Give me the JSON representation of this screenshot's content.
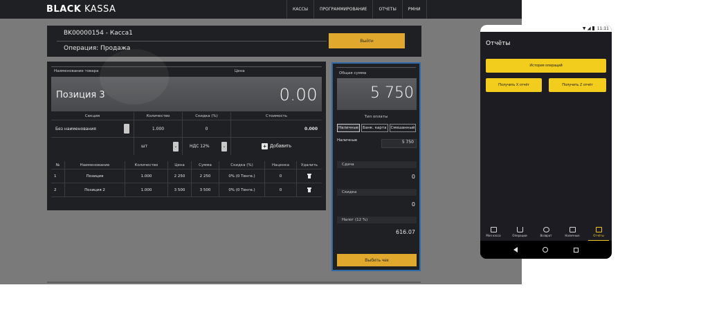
{
  "brand": {
    "bold": "BLACK",
    "light": " KASSA"
  },
  "nav": [
    "КАССЫ",
    "ПРОГРАММИРОВАНИЕ",
    "ОТЧЕТЫ",
    "РМНИ"
  ],
  "header": {
    "kassa_name": "BK00000154 - Касса1",
    "operation": "Операция: Продажа",
    "exit_label": "Выйти"
  },
  "item": {
    "name_label": "Наименование товара",
    "price_label": "Цена",
    "name": "Позиция 3",
    "price": "0.00"
  },
  "entry": {
    "headers": [
      "Секция",
      "Количество",
      "Скидка (%)",
      "Стоимость"
    ],
    "section_value": "Без наименования",
    "quantity": "1.000",
    "discount": "0",
    "cost": "0.000",
    "unit": "шт",
    "tax": "НДС 12%",
    "add_label": "Добавить"
  },
  "table": {
    "headers": [
      "№",
      "Наименование",
      "Количество",
      "Цена",
      "Сумма",
      "Скидка (%)",
      "Наценка",
      "Удалить"
    ],
    "rows": [
      [
        "1",
        "Позиция",
        "1.000",
        "2 250",
        "2 250",
        "0% (0 Тенге.)",
        "0"
      ],
      [
        "2",
        "Позиция 2",
        "1.000",
        "3 500",
        "3 500",
        "0% (0 Тенге.)",
        "0"
      ]
    ]
  },
  "payment": {
    "total_label": "Общая сумма",
    "total": "5 750",
    "paytype_label": "Тип оплаты",
    "paytypes": [
      "Наличные",
      "Банк. карта",
      "Смешанный"
    ],
    "cash_label": "Наличные",
    "cash_value": "5 750",
    "change_label": "Сдача",
    "change_value": "0",
    "discount_label": "Скидка",
    "discount_value": "0",
    "tax_label": "Налог (12 %)",
    "tax_value": "616.07",
    "punch_label": "Выбить чек"
  },
  "phone": {
    "time": "11:11",
    "title": "Отчёты",
    "history_label": "История операций",
    "x_label": "Получить X отчёт",
    "z_label": "Получить Z отчёт",
    "bottom_nav": [
      "Моя касса",
      "Операции",
      "Возврат",
      "Наличные",
      "Отчёты"
    ]
  },
  "colors": {
    "accent": "#e0a92d",
    "phone_accent": "#f2cd1e",
    "link_blue": "#3fa1e6",
    "panel": "#1f2023"
  }
}
